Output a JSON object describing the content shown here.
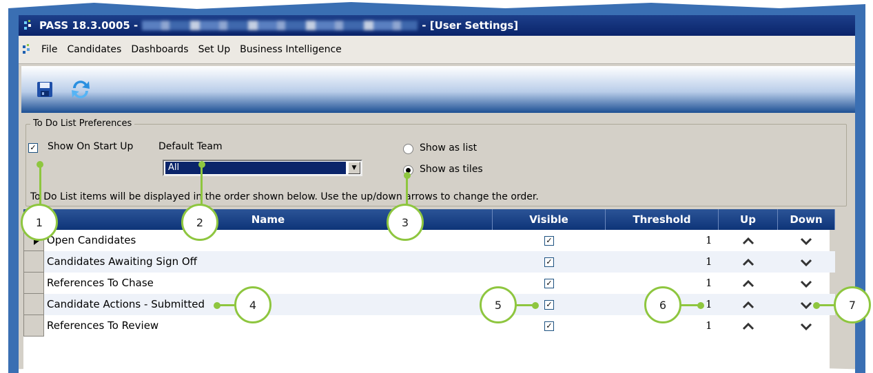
{
  "window": {
    "title_prefix": "PASS 18.3.0005 -",
    "title_suffix": "- [User Settings]"
  },
  "menu": {
    "items": [
      "File",
      "Candidates",
      "Dashboards",
      "Set Up",
      "Business Intelligence"
    ]
  },
  "toolbar": {
    "save_icon": "save-icon",
    "refresh_icon": "refresh-icon"
  },
  "preferences": {
    "group_label": "To Do List Preferences",
    "show_on_startup_label": "Show On Start Up",
    "show_on_startup_checked": true,
    "default_team_label": "Default Team",
    "default_team_value": "All",
    "show_as_list_label": "Show as list",
    "show_as_tiles_label": "Show as tiles",
    "selected_view": "tiles",
    "instruction": "To Do List items will be displayed in the order shown below. Use the up/down arrows to change the order."
  },
  "grid": {
    "columns": {
      "name": "Name",
      "visible": "Visible",
      "threshold": "Threshold",
      "up": "Up",
      "down": "Down"
    },
    "rows": [
      {
        "name": "Open Candidates",
        "visible": true,
        "threshold": "1"
      },
      {
        "name": "Candidates Awaiting Sign Off",
        "visible": true,
        "threshold": "1"
      },
      {
        "name": "References To Chase",
        "visible": true,
        "threshold": "1"
      },
      {
        "name": "Candidate Actions - Submitted",
        "visible": true,
        "threshold": "1"
      },
      {
        "name": "References To Review",
        "visible": true,
        "threshold": "1"
      }
    ]
  },
  "callouts": [
    "1",
    "2",
    "3",
    "4",
    "5",
    "6",
    "7"
  ],
  "colors": {
    "title_bar": "#0a246a",
    "grid_header": "#1b4186",
    "callout_green": "#8ec63f",
    "frame_blue": "#3a6fb3"
  }
}
